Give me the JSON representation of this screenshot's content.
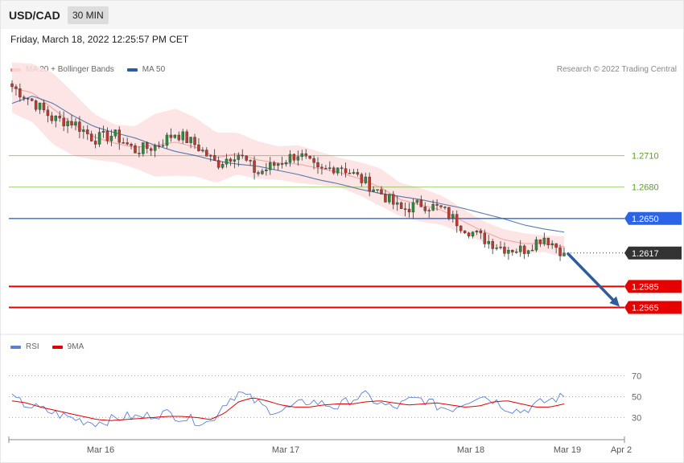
{
  "header": {
    "symbol": "USD/CAD",
    "timeframe": "30 MIN"
  },
  "timestamp": "Friday, March 18, 2022 12:25:57 PM CET",
  "credit": "Research © 2022 Trading Central",
  "legend_main": [
    {
      "label": "MA 20 + Bollinger Bands",
      "color": "#f08080"
    },
    {
      "label": "MA 50",
      "color": "#2f5c9a"
    }
  ],
  "legend_rsi": [
    {
      "label": "RSI",
      "color": "#5b7fd6"
    },
    {
      "label": "9MA",
      "color": "#e00000"
    }
  ],
  "chart_data": {
    "type": "candlestick",
    "y_range": [
      1.254,
      1.2805
    ],
    "horizontal_levels": [
      {
        "value": 1.271,
        "label": "1.2710",
        "style": "resistance-thin",
        "color": "#7fbf3f"
      },
      {
        "value": 1.268,
        "label": "1.2680",
        "style": "resistance-thin",
        "color": "#7fbf3f"
      },
      {
        "value": 1.265,
        "label": "1.2650",
        "style": "pivot",
        "color": "#2b65e6"
      },
      {
        "value": 1.2617,
        "label": "1.2617",
        "style": "current",
        "color": "#333333"
      },
      {
        "value": 1.2585,
        "label": "1.2585",
        "style": "support",
        "color": "#e60000"
      },
      {
        "value": 1.2565,
        "label": "1.2565",
        "style": "support",
        "color": "#e60000"
      }
    ],
    "x_ticks": [
      "Mar 16",
      "Mar 17",
      "Mar 18",
      "Mar 19",
      "Apr 2"
    ],
    "price_anchors": [
      1.2776,
      1.2762,
      1.2745,
      1.2742,
      1.2726,
      1.273,
      1.2715,
      1.2719,
      1.2732,
      1.272,
      1.2702,
      1.2713,
      1.2693,
      1.2703,
      1.2712,
      1.2694,
      1.2701,
      1.2688,
      1.2675,
      1.2658,
      1.2664,
      1.2659,
      1.2643,
      1.2631,
      1.2622,
      1.262,
      1.2633,
      1.2617
    ],
    "price_min": 1.2602,
    "price_max": 1.278,
    "candle_count": 140,
    "ma20_anchors": [
      1.2775,
      1.277,
      1.2755,
      1.274,
      1.2728,
      1.2722,
      1.2718,
      1.272,
      1.2723,
      1.2718,
      1.2708,
      1.2712,
      1.2706,
      1.2703,
      1.2702,
      1.2698,
      1.2694,
      1.2688,
      1.268,
      1.2668,
      1.2663,
      1.2658,
      1.2648,
      1.2638,
      1.263,
      1.2626,
      1.2626,
      1.2623
    ],
    "bb_width_anchors": [
      0.0024,
      0.0028,
      0.0034,
      0.003,
      0.0022,
      0.0018,
      0.002,
      0.003,
      0.0032,
      0.0028,
      0.0024,
      0.002,
      0.0018,
      0.0016,
      0.0018,
      0.0016,
      0.0014,
      0.0016,
      0.0018,
      0.0016,
      0.0016,
      0.0014,
      0.0012,
      0.001,
      0.001,
      0.001,
      0.0008,
      0.001
    ],
    "ma50_anchors": [
      1.276,
      1.2767,
      1.276,
      1.2748,
      1.2738,
      1.2732,
      1.2727,
      1.272,
      1.2714,
      1.271,
      1.2705,
      1.2702,
      1.27,
      1.2696,
      1.2692,
      1.2687,
      1.2683,
      1.2678,
      1.2674,
      1.2671,
      1.2668,
      1.2664,
      1.266,
      1.2655,
      1.265,
      1.2644,
      1.264,
      1.2637
    ],
    "forecast_arrow": {
      "from": 1.2617,
      "to": 1.2565,
      "direction": "down"
    },
    "rsi": {
      "y_range": [
        14,
        86
      ],
      "levels": [
        70,
        50,
        30
      ],
      "current": 50,
      "rsi_anchors": [
        48,
        42,
        38,
        34,
        30,
        27,
        25,
        28,
        31,
        30,
        33,
        34,
        30,
        27,
        25,
        44,
        54,
        47,
        38,
        36,
        41,
        46,
        43,
        40,
        48,
        51,
        43,
        39,
        46,
        48,
        41,
        38,
        45,
        52,
        47,
        39,
        36,
        42,
        47,
        50
      ],
      "ma9_anchors": [
        46,
        44,
        40,
        37,
        34,
        31,
        28,
        27,
        28,
        29,
        30,
        31,
        31,
        30,
        28,
        34,
        45,
        49,
        46,
        42,
        40,
        40,
        42,
        43,
        43,
        45,
        46,
        44,
        42,
        43,
        44,
        42,
        40,
        41,
        45,
        46,
        43,
        40,
        40,
        43
      ]
    }
  }
}
